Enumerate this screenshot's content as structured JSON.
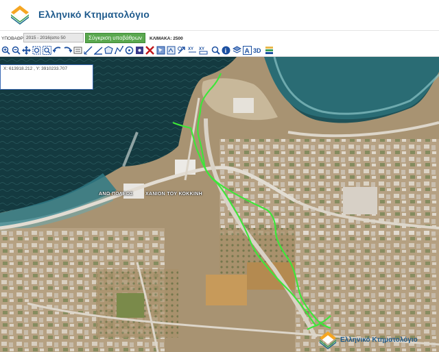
{
  "header": {
    "logo_text": "Ελληνικό Κτηματολόγιο",
    "logo_icon": "ktimatologio-logo-icon"
  },
  "toolbar": {
    "basemap_label": "ΥΠΟΒΑΘΡΟ:",
    "basemap_select": "2015 - 2016(απο 50",
    "compare_label": "Σύγκριση υποβάθρων",
    "scale_label": "ΚΛΙΜΑΚΑ: 2500"
  },
  "tools": [
    "zoom-in-icon",
    "zoom-out-icon",
    "pan-icon",
    "zoom-extent-icon",
    "zoom-window-icon",
    "previous-view-icon",
    "next-view-icon",
    "info-icon",
    "measure-line-icon",
    "measure-angle-icon",
    "measure-area-icon",
    "draw-polygon-icon",
    "draw-circle-icon",
    "point-icon",
    "select-icon",
    "clear-icon",
    "print-icon",
    "export-icon",
    "coordinates-xy-icon",
    "coordinates-input-icon",
    "search-icon",
    "help-icon",
    "layers-icon",
    "text-icon",
    "3d-icon",
    "legend-icon"
  ],
  "coords": {
    "text": "X: 613918.212 , Y: 3910233.707"
  },
  "map": {
    "places": [
      "ΑΝΩ ΠΟΛΕΩΣ",
      "ΧΑΝΙΟΝ ΤΟΥ ΚΟΚΚΙΝΗ"
    ],
    "track_color": "#3ee63a"
  },
  "watermark": {
    "text": "Ελληνικό Κτηματολόγιο"
  }
}
